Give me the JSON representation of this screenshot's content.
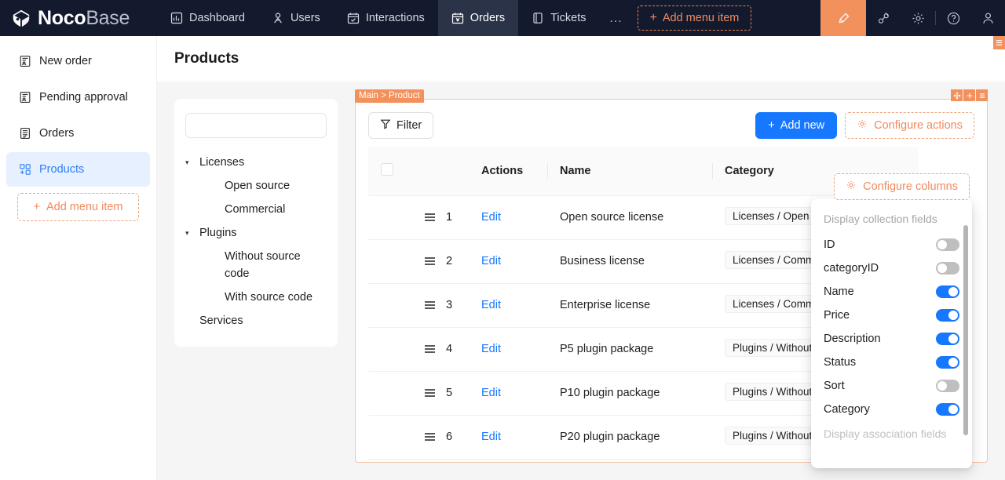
{
  "brand": {
    "name_bold": "Noco",
    "name_light": "Base",
    "logo_icon": "nocobase-logo-icon"
  },
  "topnav": {
    "tabs": [
      {
        "label": "Dashboard",
        "icon": "chart-bar-icon",
        "active": false
      },
      {
        "label": "Users",
        "icon": "user-group-icon",
        "active": false
      },
      {
        "label": "Interactions",
        "icon": "calendar-check-icon",
        "active": false
      },
      {
        "label": "Orders",
        "icon": "calendar-yen-icon",
        "active": true
      },
      {
        "label": "Tickets",
        "icon": "ticket-icon",
        "active": false
      }
    ],
    "more_label": "…",
    "add_menu_item": {
      "label": "Add menu item",
      "plus": "+"
    },
    "right_icons": [
      {
        "name": "highlighter-icon",
        "highlight": true
      },
      {
        "name": "plugin-icon",
        "highlight": false
      },
      {
        "name": "gear-icon",
        "highlight": false
      },
      {
        "name": "help-circle-icon",
        "highlight": false
      },
      {
        "name": "user-avatar-icon",
        "highlight": false
      }
    ],
    "edge_flag_icon": "page-settings-icon"
  },
  "sidebar": {
    "items": [
      {
        "label": "New order",
        "icon": "order-form-icon",
        "active": false
      },
      {
        "label": "Pending approval",
        "icon": "order-form-icon",
        "active": false
      },
      {
        "label": "Orders",
        "icon": "document-list-icon",
        "active": false
      },
      {
        "label": "Products",
        "icon": "grid-plus-icon",
        "active": true
      }
    ],
    "add_menu_item": {
      "label": "Add menu item",
      "plus": "+"
    }
  },
  "page": {
    "title": "Products"
  },
  "tree_panel": {
    "search": {
      "value": "",
      "placeholder": ""
    },
    "nodes": [
      {
        "label": "Licenses",
        "level": 0,
        "expandable": true,
        "caret": "▾"
      },
      {
        "label": "Open source",
        "level": 1,
        "expandable": false,
        "caret": ""
      },
      {
        "label": "Commercial",
        "level": 1,
        "expandable": false,
        "caret": ""
      },
      {
        "label": "Plugins",
        "level": 0,
        "expandable": true,
        "caret": "▾"
      },
      {
        "label": "Without source code",
        "level": 1,
        "expandable": false,
        "caret": ""
      },
      {
        "label": "With source code",
        "level": 1,
        "expandable": false,
        "caret": ""
      },
      {
        "label": "Services",
        "level": 0,
        "expandable": false,
        "caret": ""
      }
    ]
  },
  "table_block": {
    "tag": "Main > Product",
    "corner_buttons": [
      {
        "name": "drag-move-icon"
      },
      {
        "name": "plus-icon"
      },
      {
        "name": "menu-icon"
      }
    ],
    "toolbar": {
      "filter_label": "Filter",
      "filter_icon": "funnel-icon",
      "add_new_label": "Add new",
      "add_new_plus": "+",
      "configure_actions_label": "Configure actions",
      "configure_actions_icon": "gear-icon"
    },
    "columns": [
      {
        "key": "check",
        "label": ""
      },
      {
        "key": "index",
        "label": ""
      },
      {
        "key": "actions",
        "label": "Actions"
      },
      {
        "key": "name",
        "label": "Name"
      },
      {
        "key": "category",
        "label": "Category"
      }
    ],
    "rows": [
      {
        "index": "1",
        "action": "Edit",
        "name": "Open source license",
        "category": "Licenses / Open source"
      },
      {
        "index": "2",
        "action": "Edit",
        "name": "Business license",
        "category": "Licenses / Commercial"
      },
      {
        "index": "3",
        "action": "Edit",
        "name": "Enterprise license",
        "category": "Licenses / Commercial"
      },
      {
        "index": "4",
        "action": "Edit",
        "name": "P5 plugin package",
        "category": "Plugins / Without source code"
      },
      {
        "index": "5",
        "action": "Edit",
        "name": "P10 plugin package",
        "category": "Plugins / Without source code"
      },
      {
        "index": "6",
        "action": "Edit",
        "name": "P20 plugin package",
        "category": "Plugins / Without source code"
      }
    ]
  },
  "configure_columns": {
    "button_label": "Configure columns",
    "button_icon": "gear-icon",
    "section_title": "Display collection fields",
    "fields": [
      {
        "label": "ID",
        "on": false
      },
      {
        "label": "categoryID",
        "on": false
      },
      {
        "label": "Name",
        "on": true
      },
      {
        "label": "Price",
        "on": true
      },
      {
        "label": "Description",
        "on": true
      },
      {
        "label": "Status",
        "on": true
      },
      {
        "label": "Sort",
        "on": false
      },
      {
        "label": "Category",
        "on": true
      }
    ],
    "footer_title": "Display association fields"
  },
  "colors": {
    "brand_dark": "#141a2e",
    "accent_orange": "#f3915c",
    "primary_blue": "#1677ff",
    "active_side_bg": "#e6f0ff",
    "active_side_text": "#2e7ef7"
  }
}
